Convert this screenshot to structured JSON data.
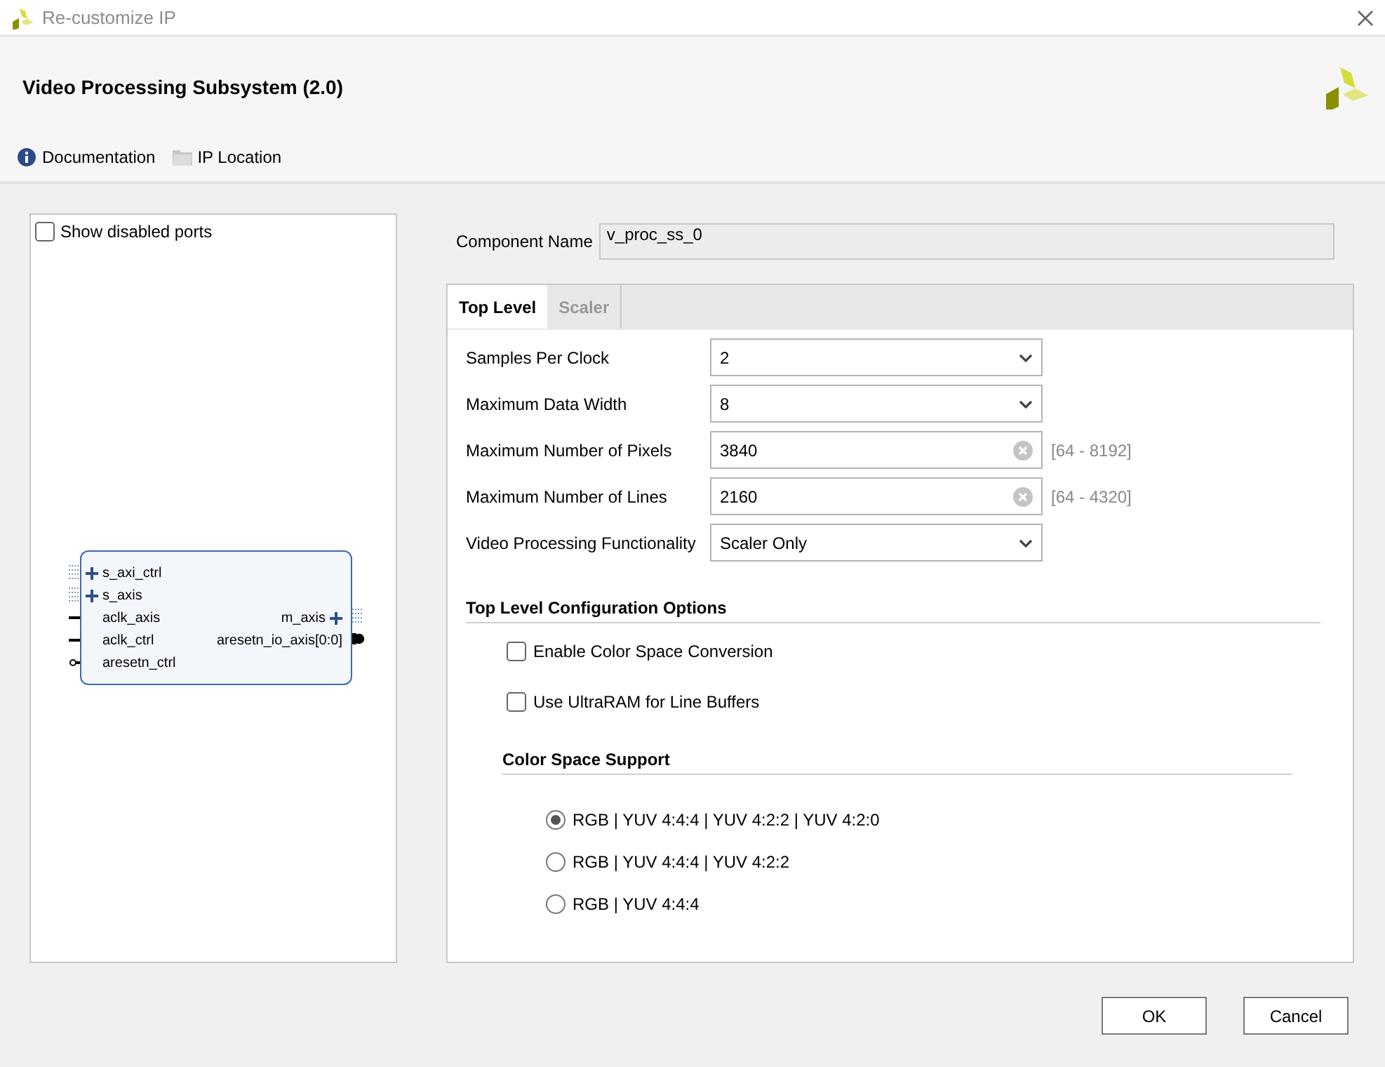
{
  "window": {
    "title": "Re-customize IP"
  },
  "header": {
    "title": "Video Processing Subsystem (2.0)",
    "links": [
      {
        "kind": "info",
        "label": "Documentation"
      },
      {
        "kind": "folder",
        "label": "IP Location"
      }
    ]
  },
  "symbol": {
    "show_disabled_ports": {
      "label": "Show disabled ports",
      "checked": false
    },
    "left_ports": [
      {
        "kind": "bus",
        "label": "s_axi_ctrl"
      },
      {
        "kind": "bus",
        "label": "s_axis"
      },
      {
        "kind": "wire",
        "label": "aclk_axis"
      },
      {
        "kind": "wire",
        "label": "aclk_ctrl"
      },
      {
        "kind": "reset",
        "label": "aresetn_ctrl"
      }
    ],
    "right_ports": [
      {
        "kind": "bus",
        "label": "m_axis"
      },
      {
        "kind": "reset_out",
        "label": "aresetn_io_axis[0:0]"
      }
    ]
  },
  "component_name": {
    "label": "Component Name",
    "value": "v_proc_ss_0"
  },
  "tabs": [
    {
      "label": "Top Level",
      "selected": true
    },
    {
      "label": "Scaler",
      "selected": false
    }
  ],
  "params": [
    {
      "kind": "dropdown",
      "label": "Samples Per Clock",
      "value": "2"
    },
    {
      "kind": "dropdown",
      "label": "Maximum Data Width",
      "value": "8"
    },
    {
      "kind": "number",
      "label": "Maximum Number of Pixels",
      "value": "3840",
      "range": "[64 - 8192]"
    },
    {
      "kind": "number",
      "label": "Maximum Number of Lines",
      "value": "2160",
      "range": "[64 - 4320]"
    },
    {
      "kind": "dropdown",
      "label": "Video Processing Functionality",
      "value": "Scaler Only"
    }
  ],
  "options": {
    "title": "Top Level Configuration Options",
    "checkboxes": [
      {
        "label": "Enable Color Space Conversion",
        "checked": false
      },
      {
        "label": "Use UltraRAM for Line Buffers",
        "checked": false
      }
    ]
  },
  "color_space": {
    "title": "Color Space Support",
    "choices": [
      {
        "label": "RGB | YUV 4:4:4 | YUV 4:2:2 | YUV 4:2:0",
        "selected": true
      },
      {
        "label": "RGB | YUV 4:4:4 | YUV 4:2:2",
        "selected": false
      },
      {
        "label": "RGB | YUV 4:4:4",
        "selected": false
      }
    ]
  },
  "buttons": [
    {
      "label": "OK"
    },
    {
      "label": "Cancel"
    }
  ]
}
